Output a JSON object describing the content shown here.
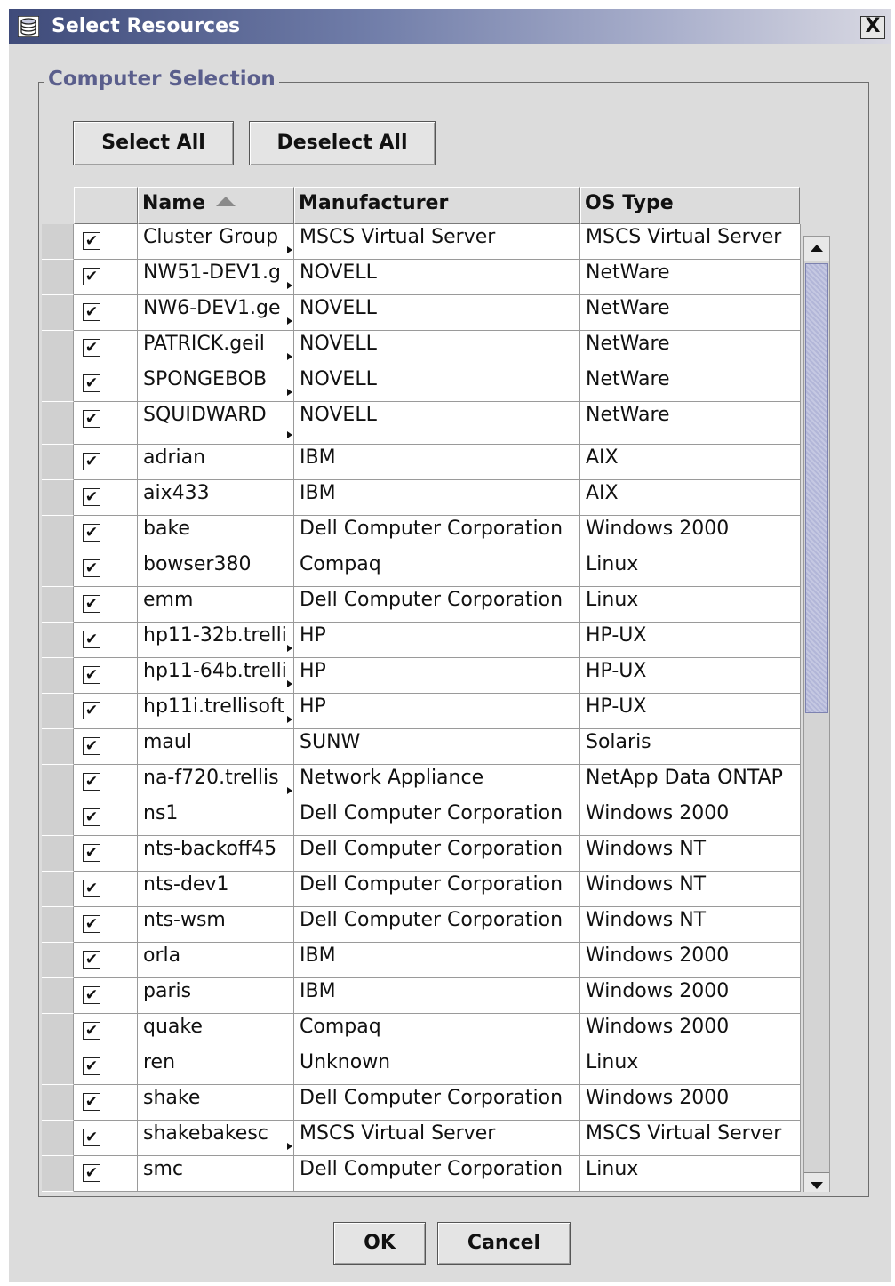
{
  "window": {
    "title": "Select Resources",
    "close_label": "X",
    "title_icon": "database-icon"
  },
  "group": {
    "title": "Computer Selection"
  },
  "buttons": {
    "select_all": "Select All",
    "deselect_all": "Deselect All",
    "ok": "OK",
    "cancel": "Cancel"
  },
  "table": {
    "columns": [
      "Name",
      "Manufacturer",
      "OS Type"
    ],
    "sort_column": "Name",
    "sort_direction": "ascending",
    "rows": [
      {
        "checked": true,
        "name": "Cluster Group",
        "truncated": true,
        "manufacturer": "MSCS Virtual Server",
        "os": "MSCS Virtual Server"
      },
      {
        "checked": true,
        "name": "NW51-DEV1.g",
        "truncated": true,
        "manufacturer": "NOVELL",
        "os": "NetWare"
      },
      {
        "checked": true,
        "name": "NW6-DEV1.ge",
        "truncated": true,
        "manufacturer": "NOVELL",
        "os": "NetWare"
      },
      {
        "checked": true,
        "name": "PATRICK.geil",
        "truncated": true,
        "manufacturer": "NOVELL",
        "os": "NetWare"
      },
      {
        "checked": true,
        "name": "SPONGEBOB",
        "truncated": true,
        "manufacturer": "NOVELL",
        "os": "NetWare"
      },
      {
        "checked": true,
        "name": "SQUIDWARD",
        "truncated": true,
        "manufacturer": "NOVELL",
        "os": "NetWare"
      },
      {
        "checked": true,
        "name": "adrian",
        "truncated": false,
        "manufacturer": "IBM",
        "os": "AIX"
      },
      {
        "checked": true,
        "name": "aix433",
        "truncated": false,
        "manufacturer": "IBM",
        "os": "AIX"
      },
      {
        "checked": true,
        "name": "bake",
        "truncated": false,
        "manufacturer": "Dell Computer Corporation",
        "os": "Windows 2000"
      },
      {
        "checked": true,
        "name": "bowser380",
        "truncated": false,
        "manufacturer": "Compaq",
        "os": "Linux"
      },
      {
        "checked": true,
        "name": "emm",
        "truncated": false,
        "manufacturer": "Dell Computer Corporation",
        "os": "Linux"
      },
      {
        "checked": true,
        "name": "hp11-32b.trelli",
        "truncated": true,
        "manufacturer": "HP",
        "os": "HP-UX"
      },
      {
        "checked": true,
        "name": "hp11-64b.trelli",
        "truncated": true,
        "manufacturer": "HP",
        "os": "HP-UX"
      },
      {
        "checked": true,
        "name": "hp11i.trellisoft",
        "truncated": true,
        "manufacturer": "HP",
        "os": "HP-UX"
      },
      {
        "checked": true,
        "name": "maul",
        "truncated": false,
        "manufacturer": "SUNW",
        "os": "Solaris"
      },
      {
        "checked": true,
        "name": "na-f720.trellis",
        "truncated": true,
        "manufacturer": "Network Appliance",
        "os": "NetApp Data ONTAP"
      },
      {
        "checked": true,
        "name": "ns1",
        "truncated": false,
        "manufacturer": "Dell Computer Corporation",
        "os": "Windows 2000"
      },
      {
        "checked": true,
        "name": "nts-backoff45",
        "truncated": false,
        "manufacturer": "Dell Computer Corporation",
        "os": "Windows NT"
      },
      {
        "checked": true,
        "name": "nts-dev1",
        "truncated": false,
        "manufacturer": "Dell Computer Corporation",
        "os": "Windows NT"
      },
      {
        "checked": true,
        "name": "nts-wsm",
        "truncated": false,
        "manufacturer": "Dell Computer Corporation",
        "os": "Windows NT"
      },
      {
        "checked": true,
        "name": "orla",
        "truncated": false,
        "manufacturer": "IBM",
        "os": "Windows 2000"
      },
      {
        "checked": true,
        "name": "paris",
        "truncated": false,
        "manufacturer": "IBM",
        "os": "Windows 2000"
      },
      {
        "checked": true,
        "name": "quake",
        "truncated": false,
        "manufacturer": "Compaq",
        "os": "Windows 2000"
      },
      {
        "checked": true,
        "name": "ren",
        "truncated": false,
        "manufacturer": "Unknown",
        "os": "Linux"
      },
      {
        "checked": true,
        "name": "shake",
        "truncated": false,
        "manufacturer": "Dell Computer Corporation",
        "os": "Windows 2000"
      },
      {
        "checked": true,
        "name": "shakebakesc",
        "truncated": true,
        "manufacturer": "MSCS Virtual Server",
        "os": "MSCS Virtual Server"
      },
      {
        "checked": true,
        "name": "smc",
        "truncated": false,
        "manufacturer": "Dell Computer Corporation",
        "os": "Linux"
      }
    ]
  },
  "colors": {
    "dialog_bg": "#dcdcdc",
    "title_gradient_start": "#3f4b7a",
    "group_title": "#5a5e8c",
    "scroll_thumb": "#b2b6d8"
  }
}
